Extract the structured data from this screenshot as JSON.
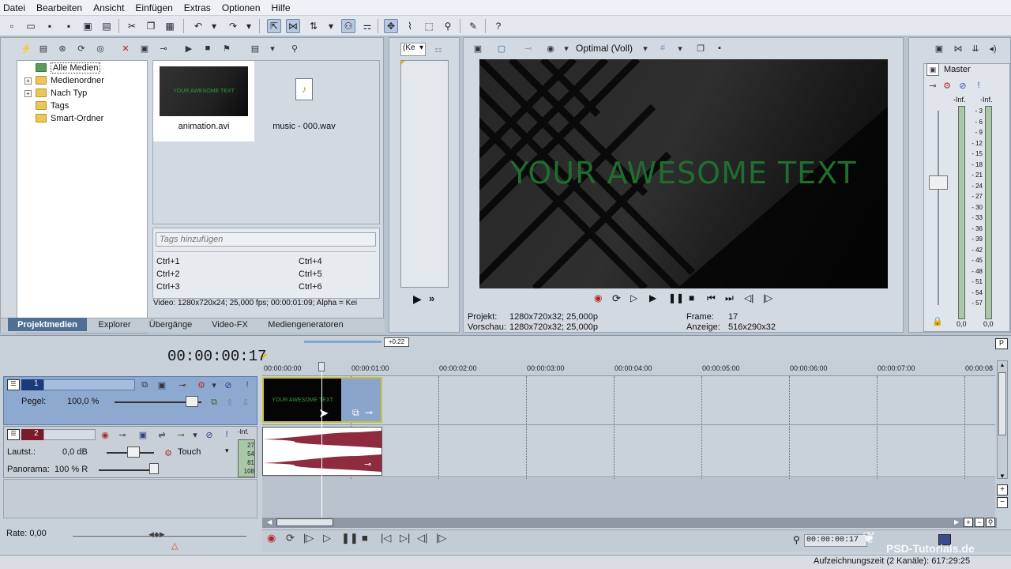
{
  "menu": [
    "Datei",
    "Bearbeiten",
    "Ansicht",
    "Einfügen",
    "Extras",
    "Optionen",
    "Hilfe"
  ],
  "tree": {
    "items": [
      {
        "label": "Alle Medien",
        "selected": true,
        "expandable": false
      },
      {
        "label": "Medienordner",
        "selected": false,
        "expandable": true
      },
      {
        "label": "Nach Typ",
        "selected": false,
        "expandable": true
      },
      {
        "label": "Tags",
        "selected": false,
        "expandable": false
      },
      {
        "label": "Smart-Ordner",
        "selected": false,
        "expandable": false
      }
    ]
  },
  "media": {
    "items": [
      {
        "name": "animation.avi",
        "thumb_text": "YOUR AWESOME TEXT"
      },
      {
        "name": "music - 000.wav"
      }
    ],
    "tags_placeholder": "Tags hinzufügen",
    "shortcuts": [
      "Ctrl+1",
      "Ctrl+4",
      "Ctrl+2",
      "Ctrl+5",
      "Ctrl+3",
      "Ctrl+6"
    ],
    "info": "Video: 1280x720x24; 25,000 fps; 00:00:01:09; Alpha = Kei"
  },
  "tabs": [
    "Projektmedien",
    "Explorer",
    "Übergänge",
    "Video-FX",
    "Mediengeneratoren"
  ],
  "trimmer": {
    "dropdown": "(Ke"
  },
  "preview": {
    "quality": "Optimal (Voll)",
    "overlay_text": "YOUR AWESOME TEXT",
    "projekt_label": "Projekt:",
    "projekt_value": "1280x720x32; 25,000p",
    "vorschau_label": "Vorschau:",
    "vorschau_value": "1280x720x32; 25,000p",
    "frame_label": "Frame:",
    "frame_value": "17",
    "anzeige_label": "Anzeige:",
    "anzeige_value": "516x290x32"
  },
  "master": {
    "label": "Master",
    "inf_left": "-Inf.",
    "inf_right": "-Inf.",
    "scale": [
      "3",
      "6",
      "9",
      "12",
      "15",
      "18",
      "21",
      "24",
      "27",
      "30",
      "33",
      "36",
      "39",
      "42",
      "45",
      "48",
      "51",
      "54",
      "57"
    ],
    "value_left": "0,0",
    "value_right": "0,0"
  },
  "timeline": {
    "timecode": "00:00:00:17",
    "loop_marker": "+0:22",
    "ruler": [
      "00:00:00:00",
      "00:00:01:00",
      "00:00:02:00",
      "00:00:03:00",
      "00:00:04:00",
      "00:00:05:00",
      "00:00:06:00",
      "00:00:07:00",
      "00:00:08"
    ],
    "clip_text": "YOUR AWESOME TEXT",
    "rate": "Rate: 0,00",
    "end_timecode": "00:00:00:17",
    "status": "Aufzeichnungszeit (2 Kanäle): 617:29:25",
    "watermark": "PSD-Tutorials.de"
  },
  "tracks": [
    {
      "number": "1",
      "pegel_label": "Pegel:",
      "pegel_value": "100,0 %"
    },
    {
      "number": "2",
      "laut_label": "Lautst.:",
      "laut_value": "0,0 dB",
      "touch": "Touch",
      "panorama_label": "Panorama:",
      "panorama_value": "100 % R",
      "meter_inf": "-Inf.",
      "meter_scale": [
        "27",
        "54",
        "81",
        "108"
      ]
    }
  ],
  "colors": {
    "accent": "#4f6f95",
    "track_video": "#8ea9cf",
    "audio_wave": "#8e2b3f",
    "preview_text": "#1f6e2f"
  }
}
